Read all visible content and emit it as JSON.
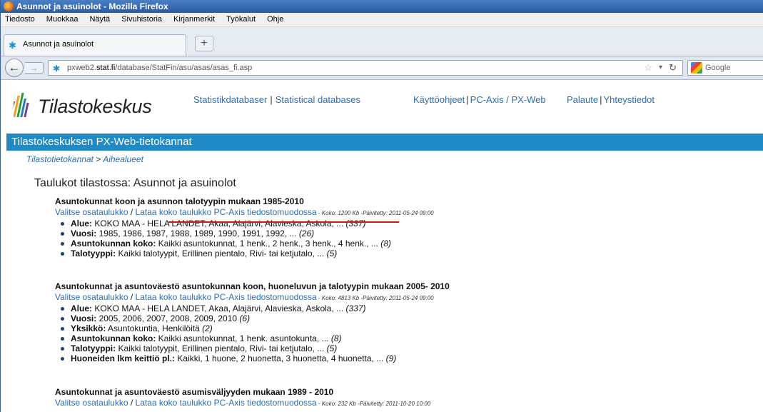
{
  "window": {
    "title": "Asunnot ja asuinolot - Mozilla Firefox"
  },
  "menu": [
    "Tiedosto",
    "Muokkaa",
    "Näytä",
    "Sivuhistoria",
    "Kirjanmerkit",
    "Työkalut",
    "Ohje"
  ],
  "tab": {
    "label": "Asunnot ja asuinolot",
    "new_tab": "+"
  },
  "nav": {
    "back": "←",
    "forward": "→",
    "url_prefix": "pxweb2.",
    "url_domain": "stat.fi",
    "url_path": "/database/StatFin/asu/asas/asas_fi.asp",
    "search_placeholder": "Google"
  },
  "site": {
    "logo_text": "Tilastokeskus",
    "links": {
      "statistikdatabaser": "Statistikdatabaser",
      "statistical_databases": "Statistical databases",
      "kayttoohjeet": "Käyttöohjeet",
      "pcaxis": "PC-Axis / PX-Web",
      "palaute": "Palaute",
      "yhteystiedot": "Yhteystiedot"
    },
    "separator": "|"
  },
  "banner": "Tilastokeskuksen PX-Web-tietokannat",
  "breadcrumb": {
    "first": "Tilastotietokannat",
    "sep": ">",
    "second": "Aihealueet"
  },
  "heading": "Taulukot tilastossa: Asunnot ja asuinolot",
  "sections": [
    {
      "title": "Asuntokunnat koon ja asunnon talotyypin mukaan 1985-2010",
      "link1": "Valitse osataulukko",
      "sep": " / ",
      "link2": "Lataa koko taulukko PC-Axis tiedostomuodossa",
      "meta": " - Koko: 1200 Kb -Päivitetty: 2011-05-24 09:00",
      "items": [
        {
          "label": "Alue:",
          "text": " KOKO MAA - HELA LANDET, Akaa, Alajärvi, Alavieska, Askola, ... ",
          "count": "(337)"
        },
        {
          "label": "Vuosi:",
          "text": " 1985, 1986, 1987, 1988, 1989, 1990, 1991, 1992, ... ",
          "count": "(26)"
        },
        {
          "label": "Asuntokunnan koko:",
          "text": " Kaikki asuntokunnat, 1 henk., 2 henk., 3 henk., 4 henk., ... ",
          "count": "(8)"
        },
        {
          "label": "Talotyyppi:",
          "text": " Kaikki talotyypit, Erillinen pientalo, Rivi- tai ketjutalo, ... ",
          "count": "(5)"
        }
      ]
    },
    {
      "title": "Asuntokunnat ja asuntoväestö asuntokunnan koon, huoneluvun ja talotyypin mukaan 2005- 2010",
      "link1": "Valitse osataulukko",
      "sep": " / ",
      "link2": "Lataa koko taulukko PC-Axis tiedostomuodossa",
      "meta": " - Koko: 4813 Kb -Päivitetty: 2011-05-24 09:00",
      "items": [
        {
          "label": "Alue:",
          "text": " KOKO MAA - HELA LANDET, Akaa, Alajärvi, Alavieska, Askola, ... ",
          "count": "(337)"
        },
        {
          "label": "Vuosi:",
          "text": " 2005, 2006, 2007, 2008, 2009, 2010 ",
          "count": "(6)"
        },
        {
          "label": "Yksikkö:",
          "text": " Asuntokuntia, Henkilöitä ",
          "count": "(2)"
        },
        {
          "label": "Asuntokunnan koko:",
          "text": " Kaikki asuntokunnat, 1 henk. asuntokunta, ... ",
          "count": "(8)"
        },
        {
          "label": "Talotyyppi:",
          "text": " Kaikki talotyypit, Erillinen pientalo, Rivi- tai ketjutalo, ... ",
          "count": "(5)"
        },
        {
          "label": "Huoneiden lkm keittiö pl.:",
          "text": " Kaikki, 1 huone, 2 huonetta, 3 huonetta, 4 huonetta, ... ",
          "count": "(9)"
        }
      ]
    },
    {
      "title": "Asuntokunnat ja asuntoväestö asumisväljyyden mukaan 1989 - 2010",
      "link1": "Valitse osataulukko",
      "sep": " / ",
      "link2": "Lataa koko taulukko PC-Axis tiedostomuodossa",
      "meta": " - Koko: 232 Kb -Päivitetty: 2011-10-20 10:00",
      "items": []
    }
  ]
}
